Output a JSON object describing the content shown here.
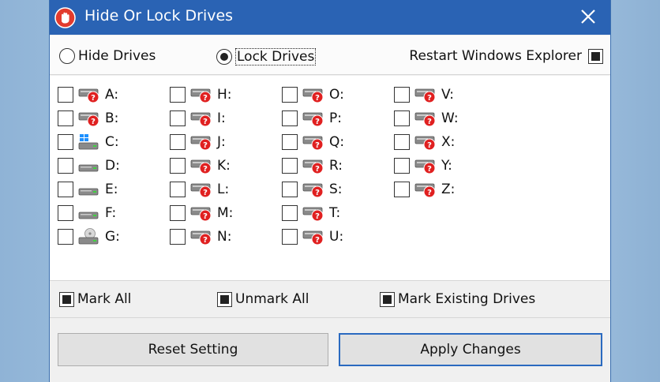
{
  "window": {
    "title": "Hide Or Lock Drives",
    "close_label": "✕"
  },
  "options": {
    "hide_drives": "Hide Drives",
    "lock_drives": "Lock Drives",
    "selected_mode": "lock",
    "restart_explorer": "Restart Windows Explorer",
    "restart_checked": true
  },
  "drives": [
    {
      "letter": "A:",
      "icon": "locked-drive-icon"
    },
    {
      "letter": "B:",
      "icon": "locked-drive-icon"
    },
    {
      "letter": "C:",
      "icon": "windows-system-drive-icon"
    },
    {
      "letter": "D:",
      "icon": "hard-drive-icon"
    },
    {
      "letter": "E:",
      "icon": "hard-drive-icon"
    },
    {
      "letter": "F:",
      "icon": "hard-drive-icon"
    },
    {
      "letter": "G:",
      "icon": "optical-drive-icon"
    },
    {
      "letter": "H:",
      "icon": "locked-drive-icon"
    },
    {
      "letter": "I:",
      "icon": "locked-drive-icon"
    },
    {
      "letter": "J:",
      "icon": "locked-drive-icon"
    },
    {
      "letter": "K:",
      "icon": "locked-drive-icon"
    },
    {
      "letter": "L:",
      "icon": "locked-drive-icon"
    },
    {
      "letter": "M:",
      "icon": "locked-drive-icon"
    },
    {
      "letter": "N:",
      "icon": "locked-drive-icon"
    },
    {
      "letter": "O:",
      "icon": "locked-drive-icon"
    },
    {
      "letter": "P:",
      "icon": "locked-drive-icon"
    },
    {
      "letter": "Q:",
      "icon": "locked-drive-icon"
    },
    {
      "letter": "R:",
      "icon": "locked-drive-icon"
    },
    {
      "letter": "S:",
      "icon": "locked-drive-icon"
    },
    {
      "letter": "T:",
      "icon": "locked-drive-icon"
    },
    {
      "letter": "U:",
      "icon": "locked-drive-icon"
    },
    {
      "letter": "V:",
      "icon": "locked-drive-icon"
    },
    {
      "letter": "W:",
      "icon": "locked-drive-icon"
    },
    {
      "letter": "X:",
      "icon": "locked-drive-icon"
    },
    {
      "letter": "Y:",
      "icon": "locked-drive-icon"
    },
    {
      "letter": "Z:",
      "icon": "locked-drive-icon"
    }
  ],
  "marks": {
    "mark_all": "Mark All",
    "unmark_all": "Unmark All",
    "mark_existing": "Mark Existing Drives"
  },
  "buttons": {
    "reset": "Reset Setting",
    "apply": "Apply Changes"
  },
  "colors": {
    "titlebar": "#2a63b4",
    "lock_badge": "#e02020",
    "focus_border": "#2a6ac0"
  }
}
